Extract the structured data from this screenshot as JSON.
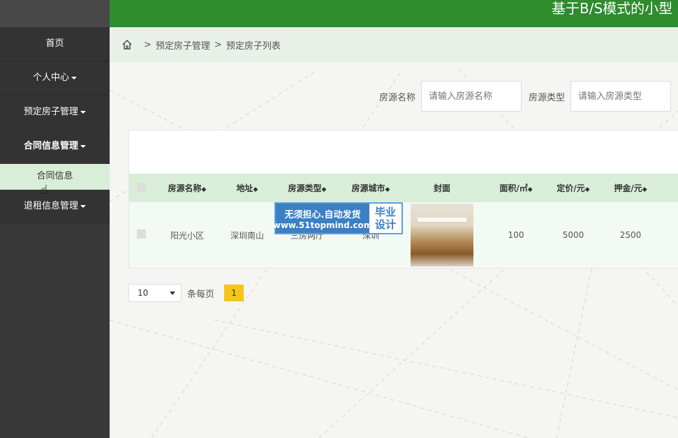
{
  "header": {
    "title": "基于B/S模式的小型"
  },
  "sidebar": {
    "items": [
      {
        "label": "首页"
      },
      {
        "label": "个人中心"
      },
      {
        "label": "预定房子管理"
      },
      {
        "label": "合同信息管理"
      },
      {
        "label": "合同信息"
      },
      {
        "label": "退租信息管理"
      }
    ]
  },
  "breadcrumb": {
    "items": [
      "预定房子管理",
      "预定房子列表"
    ],
    "separator": ">"
  },
  "search": {
    "fields": [
      {
        "label": "房源名称",
        "placeholder": "请输入房源名称"
      },
      {
        "label": "房源类型",
        "placeholder": "请输入房源类型"
      }
    ]
  },
  "table": {
    "columns": [
      "房源名称",
      "地址",
      "房源类型",
      "房源城市",
      "封面",
      "面积/㎡",
      "定价/元",
      "押金/元"
    ],
    "rows": [
      {
        "name": "阳光小区",
        "address": "深圳南山",
        "type": "三房两厅",
        "city": "深圳",
        "area": "100",
        "price": "5000",
        "deposit": "2500"
      }
    ]
  },
  "watermark": {
    "line1": "无须担心.自动发货",
    "line2": "www.51topmind.com",
    "right1": "毕业",
    "right2": "设计"
  },
  "pager": {
    "page_size": "10",
    "per_page_label": "条每页",
    "current_page": "1"
  }
}
